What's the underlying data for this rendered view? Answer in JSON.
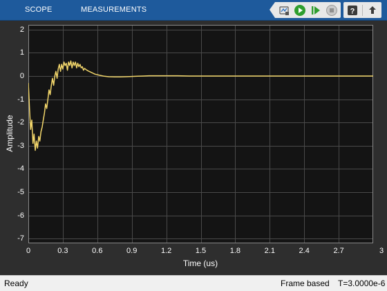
{
  "toolstrip": {
    "tabs": [
      {
        "label": "SCOPE"
      },
      {
        "label": "MEASUREMENTS"
      }
    ],
    "buttons": [
      {
        "name": "signal-selector-icon"
      },
      {
        "name": "run-icon"
      },
      {
        "name": "step-forward-icon"
      },
      {
        "name": "stop-icon"
      },
      {
        "name": "help-icon"
      },
      {
        "name": "undock-icon"
      }
    ],
    "colors": {
      "bar": "#1e5a9c",
      "run": "#2e9e2e",
      "stop": "#9b9b9b"
    }
  },
  "chart_data": {
    "type": "line",
    "title": "",
    "xlabel": "Time (us)",
    "ylabel": "Amplitude",
    "xlim": [
      0,
      3
    ],
    "ylim": [
      -7.2,
      2.2
    ],
    "grid": true,
    "xticks": [
      "0",
      "0.3",
      "0.6",
      "0.9",
      "1.2",
      "1.5",
      "1.8",
      "2.1",
      "2.4",
      "2.7",
      "3"
    ],
    "yticks": [
      "2",
      "1",
      "0",
      "-1",
      "-2",
      "-3",
      "-4",
      "-5",
      "-6",
      "-7"
    ],
    "line_color": "#f2d66b",
    "series": [
      {
        "x": [
          0,
          0.01,
          0.02,
          0.03,
          0.04,
          0.05,
          0.06,
          0.07,
          0.08,
          0.09,
          0.1,
          0.11,
          0.12,
          0.13,
          0.14,
          0.15,
          0.16,
          0.17,
          0.18,
          0.19,
          0.2,
          0.21,
          0.22,
          0.23,
          0.24,
          0.25,
          0.26,
          0.27,
          0.28,
          0.29,
          0.3,
          0.31,
          0.32,
          0.33,
          0.34,
          0.35,
          0.36,
          0.37,
          0.38,
          0.39,
          0.4,
          0.41,
          0.42,
          0.43,
          0.44,
          0.45,
          0.46,
          0.47,
          0.48,
          0.49,
          0.5,
          0.52,
          0.55,
          0.58,
          0.62,
          0.66,
          0.7,
          0.75,
          0.8,
          0.85,
          0.9,
          0.95,
          1.0,
          1.05,
          1.1,
          1.2,
          1.3,
          1.4,
          1.5,
          1.6,
          1.7,
          1.8,
          2.0,
          2.2,
          2.5,
          2.8,
          3.0
        ],
        "y": [
          -0.3,
          -1.4,
          -2.3,
          -1.9,
          -2.9,
          -2.5,
          -3.2,
          -2.8,
          -3.1,
          -2.6,
          -2.8,
          -2.4,
          -2.2,
          -1.9,
          -1.6,
          -1.2,
          -1.4,
          -1.0,
          -0.6,
          -0.8,
          -0.4,
          -0.1,
          -0.4,
          0.0,
          0.2,
          -0.1,
          0.3,
          0.5,
          0.2,
          0.5,
          0.3,
          0.6,
          0.45,
          0.55,
          0.25,
          0.6,
          0.45,
          0.65,
          0.35,
          0.6,
          0.45,
          0.6,
          0.35,
          0.55,
          0.4,
          0.5,
          0.35,
          0.4,
          0.25,
          0.33,
          0.28,
          0.22,
          0.15,
          0.08,
          0.03,
          -0.01,
          -0.03,
          -0.04,
          -0.04,
          -0.03,
          -0.02,
          -0.01,
          0.0,
          0.01,
          0.01,
          0.01,
          0.01,
          0.0,
          0.0,
          0.0,
          0.0,
          0.0,
          0.0,
          0.0,
          0.0,
          0.0,
          0.0
        ]
      }
    ]
  },
  "status": {
    "left": "Ready",
    "mode": "Frame based",
    "time": "T=3.0000e-6"
  }
}
